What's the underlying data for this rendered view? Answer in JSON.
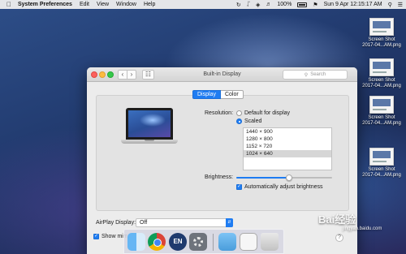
{
  "menubar": {
    "apple_icon": "apple-icon",
    "app_name": "System Preferences",
    "menus": [
      "Edit",
      "View",
      "Window",
      "Help"
    ],
    "battery_percent": "100%",
    "datetime": "Sun 9 Apr  12:15:17 AM"
  },
  "desktop": {
    "items": [
      {
        "label1": "Screen Shot",
        "label2": "2017-04...AM.png"
      },
      {
        "label1": "Screen Shot",
        "label2": "2017-04...AM.png"
      },
      {
        "label1": "Screen Shot",
        "label2": "2017-04...AM.png"
      },
      {
        "label1": "Screen Shot",
        "label2": "2017-04...AM.png"
      }
    ]
  },
  "window": {
    "title": "Built-in Display",
    "search_placeholder": "Search",
    "tabs": [
      "Display",
      "Color"
    ],
    "resolution_label": "Resolution:",
    "radio_default": "Default for display",
    "radio_scaled": "Scaled",
    "resolutions": [
      "1440 × 900",
      "1280 × 800",
      "1152 × 720",
      "1024 × 640"
    ],
    "selected_resolution": "1024 × 640",
    "brightness_label": "Brightness:",
    "brightness_level": 0.55,
    "auto_brightness": "Automatically adjust brightness",
    "airplay_label": "AirPlay Display:",
    "airplay_value": "Off",
    "show_mirroring": "Show mirr",
    "help": "?"
  },
  "dock": {
    "en_label": "EN"
  },
  "watermark": {
    "text": "Baiç»éª",
    "display": "Bai经验",
    "sub": "jingyan.baidu.com"
  }
}
